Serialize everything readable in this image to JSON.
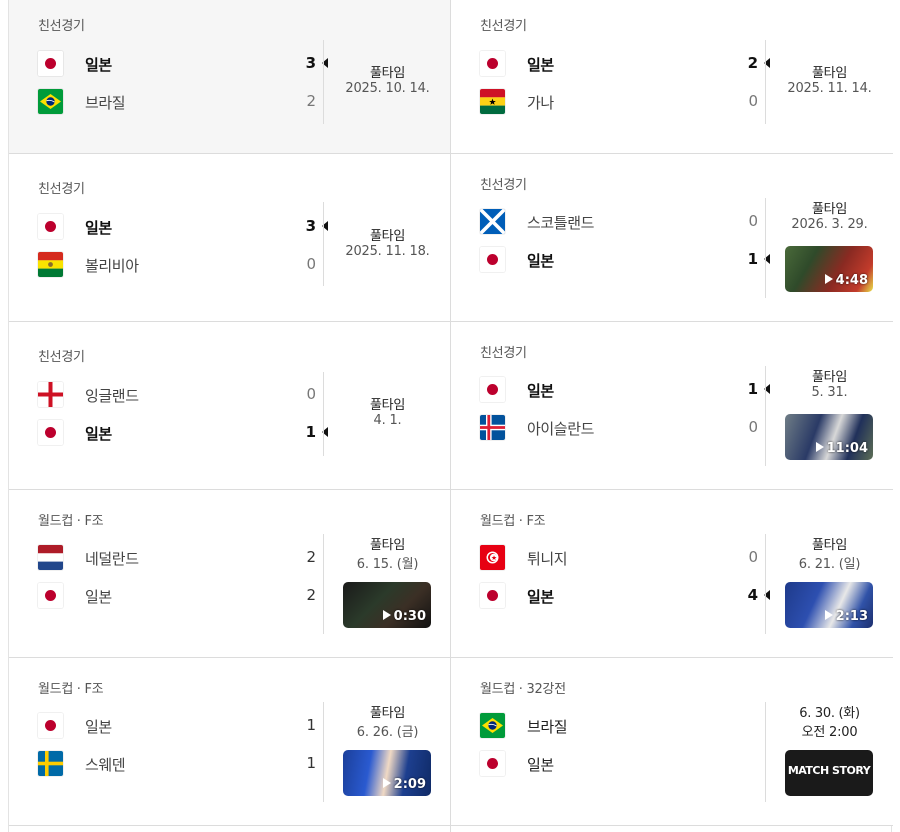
{
  "matches": [
    {
      "league": "친선경기",
      "home": {
        "name": "일본",
        "flag": "japan-flag",
        "score": "3",
        "winner": true
      },
      "away": {
        "name": "브라질",
        "flag": "brazil-flag",
        "score": "2",
        "winner": false
      },
      "status": "풀타임",
      "date": "2025. 10. 14.",
      "video": null,
      "highlighted": true
    },
    {
      "league": "친선경기",
      "home": {
        "name": "일본",
        "flag": "japan-flag",
        "score": "2",
        "winner": true
      },
      "away": {
        "name": "가나",
        "flag": "ghana-flag",
        "score": "0",
        "winner": false
      },
      "status": "풀타임",
      "date": "2025. 11. 14.",
      "video": null
    },
    {
      "league": "친선경기",
      "home": {
        "name": "일본",
        "flag": "japan-flag",
        "score": "3",
        "winner": true
      },
      "away": {
        "name": "볼리비아",
        "flag": "bolivia-flag",
        "score": "0",
        "winner": false
      },
      "status": "풀타임",
      "date": "2025. 11. 18.",
      "video": null
    },
    {
      "league": "친선경기",
      "home": {
        "name": "스코틀랜드",
        "flag": "scotland-flag",
        "score": "0",
        "winner": false
      },
      "away": {
        "name": "일본",
        "flag": "japan-flag",
        "score": "1",
        "winner": true
      },
      "status": "풀타임",
      "date": "2026. 3. 29.",
      "video": {
        "duration": "4:48",
        "badge": ""
      }
    },
    {
      "league": "친선경기",
      "home": {
        "name": "잉글랜드",
        "flag": "england-flag",
        "score": "0",
        "winner": false
      },
      "away": {
        "name": "일본",
        "flag": "japan-flag",
        "score": "1",
        "winner": true
      },
      "status": "풀타임",
      "date": "4. 1.",
      "video": null
    },
    {
      "league": "친선경기",
      "home": {
        "name": "일본",
        "flag": "japan-flag",
        "score": "1",
        "winner": true
      },
      "away": {
        "name": "아이슬란드",
        "flag": "iceland-flag",
        "score": "0",
        "winner": false
      },
      "status": "풀타임",
      "date": "5. 31.",
      "video": {
        "duration": "11:04",
        "badge": ""
      }
    },
    {
      "league": "월드컵 · F조",
      "home": {
        "name": "네덜란드",
        "flag": "netherlands-flag",
        "score": "2",
        "winner": false
      },
      "away": {
        "name": "일본",
        "flag": "japan-flag",
        "score": "2",
        "winner": false
      },
      "status": "풀타임",
      "date": "6. 15. (월)",
      "video": {
        "duration": "0:30",
        "badge": ""
      }
    },
    {
      "league": "월드컵 · F조",
      "home": {
        "name": "튀니지",
        "flag": "tunisia-flag",
        "score": "0",
        "winner": false
      },
      "away": {
        "name": "일본",
        "flag": "japan-flag",
        "score": "4",
        "winner": true
      },
      "status": "풀타임",
      "date": "6. 21. (일)",
      "video": {
        "duration": "2:13",
        "badge": ""
      }
    },
    {
      "league": "월드컵 · F조",
      "home": {
        "name": "일본",
        "flag": "japan-flag",
        "score": "1",
        "winner": false
      },
      "away": {
        "name": "스웨덴",
        "flag": "sweden-flag",
        "score": "1",
        "winner": false
      },
      "status": "풀타임",
      "date": "6. 26. (금)",
      "video": {
        "duration": "2:09",
        "badge": ""
      }
    },
    {
      "league": "월드컵 · 32강전",
      "home": {
        "name": "브라질",
        "flag": "brazil-flag",
        "score": "",
        "winner": false
      },
      "away": {
        "name": "일본",
        "flag": "japan-flag",
        "score": "",
        "winner": false
      },
      "status": "6. 30. (화)",
      "date": "오전 2:00",
      "video": {
        "duration": "",
        "badge": "MATCH STORY"
      },
      "upcoming": true
    }
  ],
  "colors": {
    "winner_text": "#111111",
    "loser_score": "#777777",
    "divider": "#dcdcdc",
    "highlight_bg": "#f6f6f6"
  }
}
